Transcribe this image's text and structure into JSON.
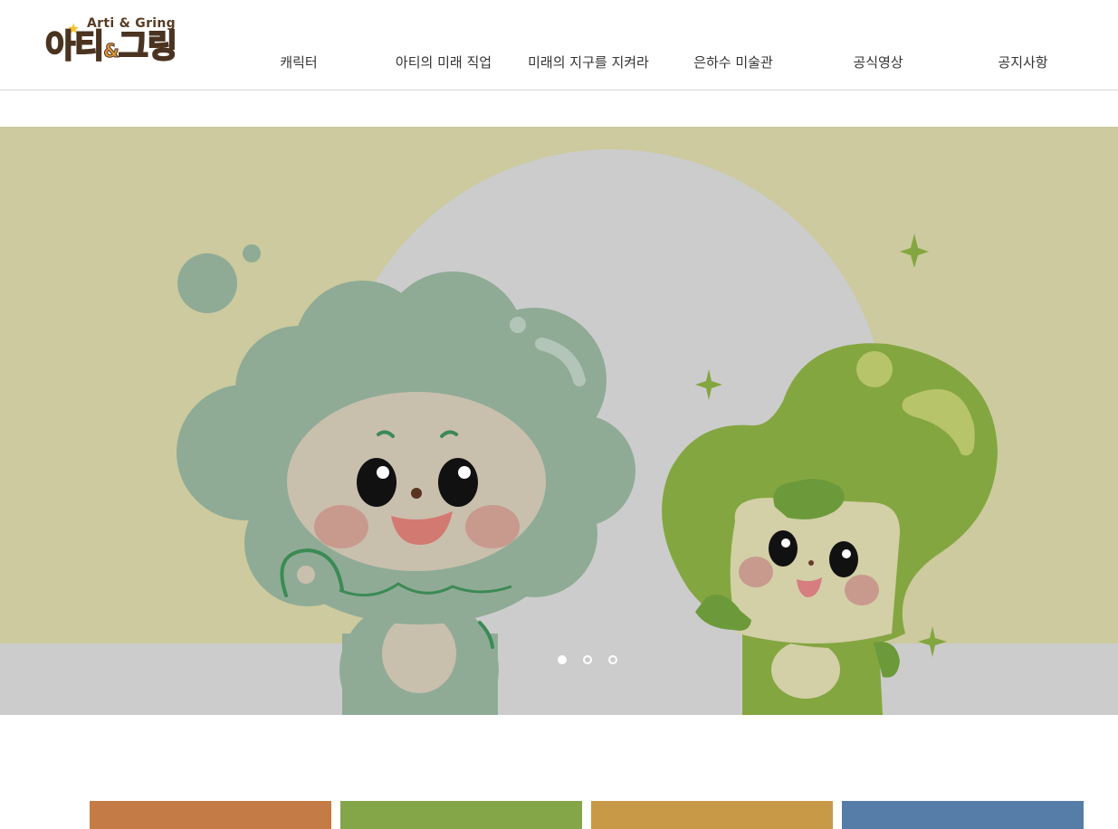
{
  "logo": {
    "subtitle": "Arti & Gring",
    "main_a": "아티",
    "main_amp": "&",
    "main_g": "그링"
  },
  "nav": {
    "items": [
      {
        "label": "캐릭터"
      },
      {
        "label": "아티의 미래 직업"
      },
      {
        "label": "미래의 지구를 지켜라"
      },
      {
        "label": "은하수 미술관"
      },
      {
        "label": "공식영상"
      },
      {
        "label": "공지사항"
      }
    ]
  },
  "hero": {
    "slide_count": 3,
    "active_slide": 1
  },
  "tiles": {
    "colors": [
      "#c57b45",
      "#84a548",
      "#c89a48",
      "#567ca8"
    ]
  },
  "colors": {
    "hero_bg": "#ccca9e",
    "circle": "#cccccc",
    "arti_body": "#8fab96",
    "gring_body": "#84a640"
  }
}
